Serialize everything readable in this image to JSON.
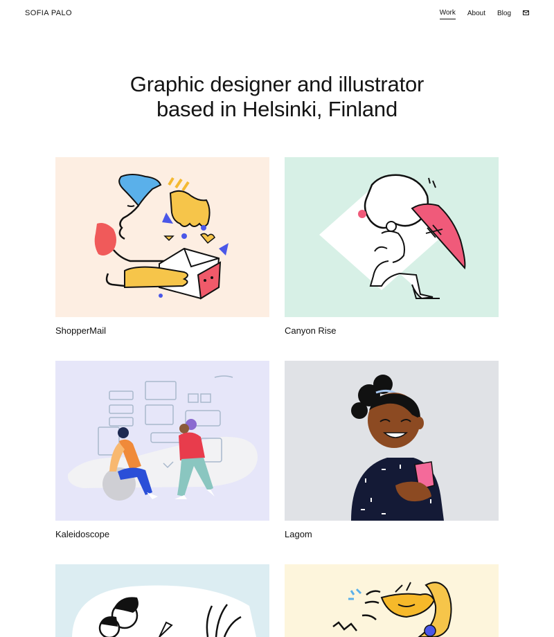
{
  "header": {
    "logo": "SOFIA PALO",
    "nav": [
      {
        "label": "Work",
        "active": true
      },
      {
        "label": "About",
        "active": false
      },
      {
        "label": "Blog",
        "active": false
      }
    ],
    "mail_icon": "envelope-icon"
  },
  "hero": {
    "line1": "Graphic designer and illustrator",
    "line2": "based in Helsinki, Finland"
  },
  "projects": [
    {
      "title": "ShopperMail",
      "bg": "#fdeee2"
    },
    {
      "title": "Canyon Rise",
      "bg": "#d7f0e6"
    },
    {
      "title": "Kaleidoscope",
      "bg": "#e6e6f9"
    },
    {
      "title": "Lagom",
      "bg": "#e0e2e6"
    },
    {
      "title": "",
      "bg": "#dcedf2"
    },
    {
      "title": "",
      "bg": "#fdf5dc"
    }
  ]
}
